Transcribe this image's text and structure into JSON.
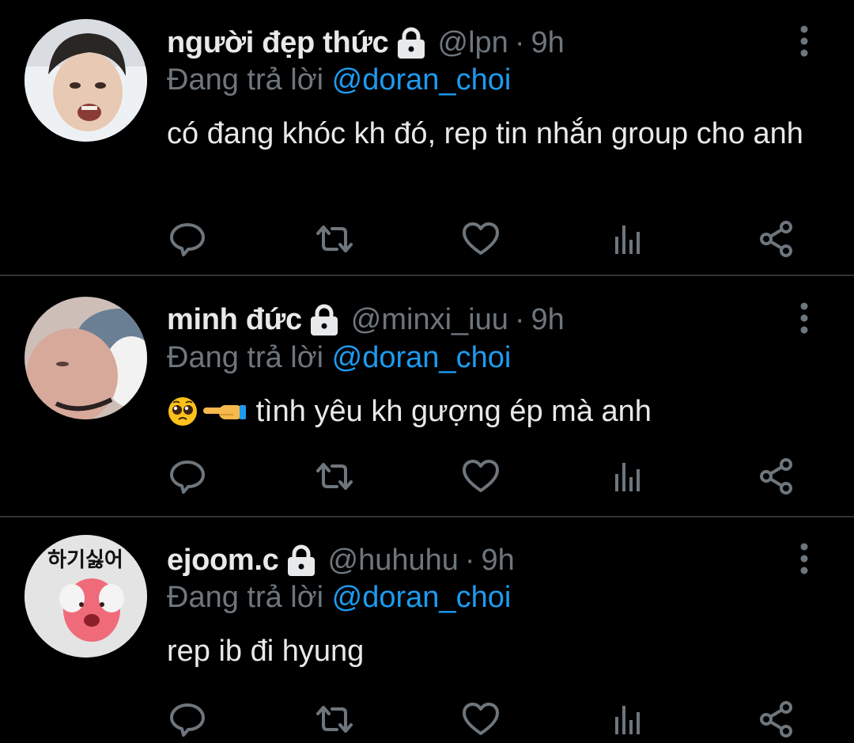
{
  "reply_prefix": "Đang trả lời",
  "colors": {
    "background": "#000000",
    "primary_text": "#e7e9ea",
    "secondary_text": "#6e767d",
    "accent": "#1d9bf0",
    "divider": "#2f3336"
  },
  "icons": {
    "lock": "lock-icon",
    "more": "more-vertical-icon",
    "reply": "reply-icon",
    "retweet": "retweet-icon",
    "like": "heart-icon",
    "stats": "analytics-icon",
    "share": "share-icon"
  },
  "tweets": [
    {
      "display_name": "người đẹp thức",
      "handle": "@lpn",
      "separator": "·",
      "time": "9h",
      "replying_to": "@doran_choi",
      "text": "có đang khóc kh đó, rep tin nhắn group cho anh",
      "protected": true
    },
    {
      "display_name": "minh đức",
      "handle": "@minxi_iuu",
      "separator": "·",
      "time": "9h",
      "replying_to": "@doran_choi",
      "emojis": [
        "pleading-face-emoji",
        "pointing-left-hand-emoji"
      ],
      "text": "tình yêu kh gượng ép mà anh",
      "protected": true
    },
    {
      "display_name": "ejoom.c",
      "handle": "@huhuhu",
      "separator": "·",
      "time": "9h",
      "replying_to": "@doran_choi",
      "text": "rep ib đi hyung",
      "avatar_text": "하기싫어",
      "protected": true
    }
  ]
}
